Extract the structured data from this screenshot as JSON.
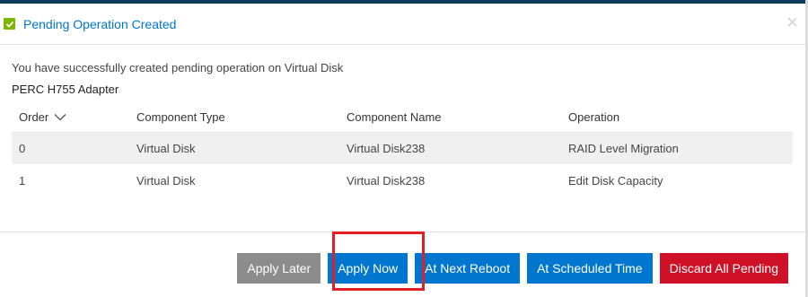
{
  "dialog": {
    "title": "Pending Operation Created",
    "close_glyph": "×",
    "message": "You have successfully created pending operation on Virtual Disk",
    "adapter": "PERC H755 Adapter"
  },
  "table": {
    "columns": [
      "Order",
      "Component Type",
      "Component Name",
      "Operation"
    ],
    "rows": [
      {
        "order": "0",
        "type": "Virtual Disk",
        "name": "Virtual Disk238",
        "operation": "RAID Level Migration"
      },
      {
        "order": "1",
        "type": "Virtual Disk",
        "name": "Virtual Disk238",
        "operation": "Edit Disk Capacity"
      }
    ]
  },
  "buttons": {
    "apply_later": "Apply Later",
    "apply_now": "Apply Now",
    "next_reboot": "At Next Reboot",
    "scheduled": "At Scheduled Time",
    "discard": "Discard All Pending"
  },
  "colors": {
    "accent": "#0076ce",
    "success": "#7ab800",
    "danger": "#ce1126",
    "highlight": "#e31e24"
  },
  "icons": [
    "check-icon",
    "close-icon",
    "chevron-down-icon"
  ]
}
